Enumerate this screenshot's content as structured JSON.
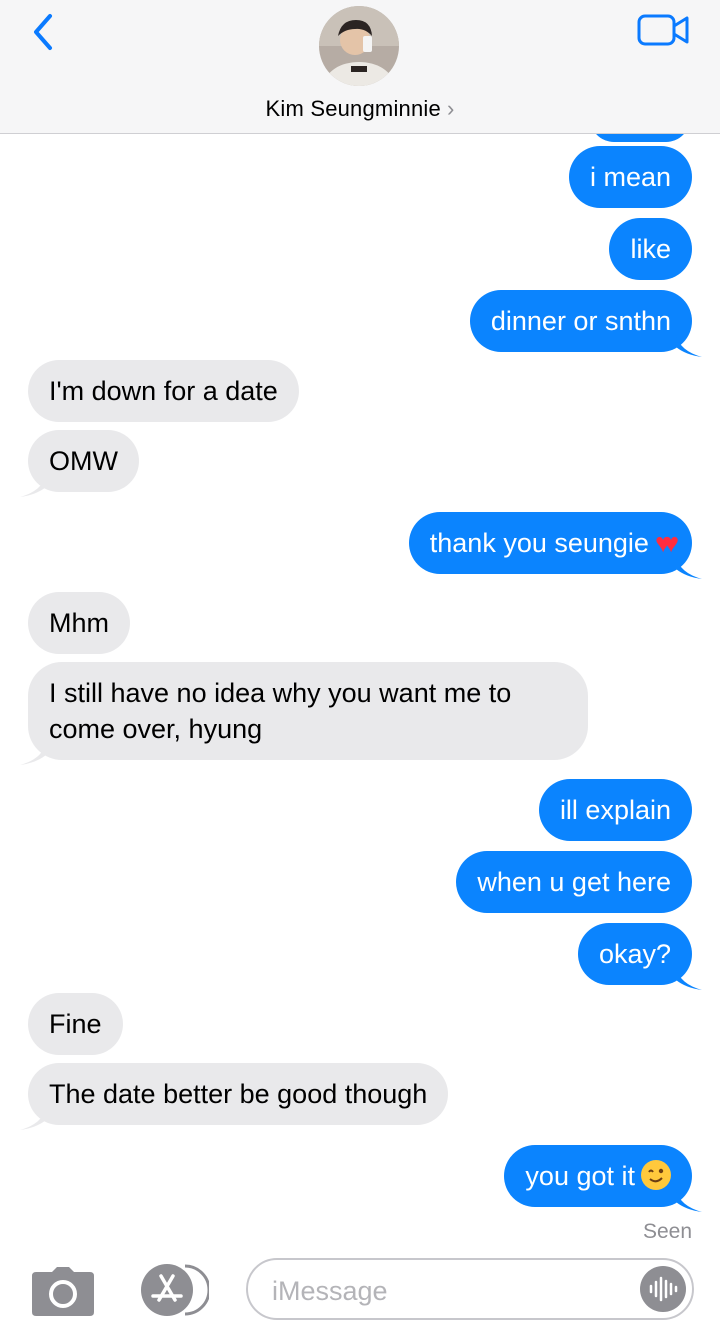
{
  "header": {
    "contact_name": "Kim Seungminnie",
    "contact_chevron": "›"
  },
  "messages": [
    {
      "from": "me",
      "text": "i mean"
    },
    {
      "from": "me",
      "text": "like"
    },
    {
      "from": "me",
      "text": "dinner or snthn"
    },
    {
      "from": "them",
      "text": "I'm down for a date"
    },
    {
      "from": "them",
      "text": "OMW"
    },
    {
      "from": "me",
      "text": "thank you seungie",
      "emoji": "❤️❤️"
    },
    {
      "from": "them",
      "text": "Mhm"
    },
    {
      "from": "them",
      "text": "I still have no idea why you want me to come over, hyung"
    },
    {
      "from": "me",
      "text": "ill explain"
    },
    {
      "from": "me",
      "text": "when u get here"
    },
    {
      "from": "me",
      "text": "okay?"
    },
    {
      "from": "them",
      "text": "Fine"
    },
    {
      "from": "them",
      "text": "The date better be good though"
    },
    {
      "from": "me",
      "text": "you got it",
      "emoji": "😉"
    }
  ],
  "status": {
    "seen": "Seen"
  },
  "compose": {
    "placeholder": "iMessage"
  },
  "icons": {
    "back": "chevron-left-icon",
    "video": "video-camera-icon",
    "camera": "camera-icon",
    "appstore": "app-store-icon",
    "audio": "audio-waveform-icon"
  },
  "colors": {
    "outgoing_bubble": "#0b84fe",
    "incoming_bubble": "#e9e9eb",
    "accent": "#0a7aff"
  }
}
